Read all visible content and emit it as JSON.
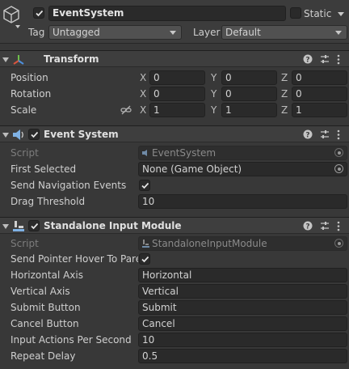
{
  "gameobject": {
    "name": "EventSystem",
    "active": true,
    "static_label": "Static",
    "static_checked": false,
    "tag_label": "Tag",
    "tag_value": "Untagged",
    "layer_label": "Layer",
    "layer_value": "Default"
  },
  "transform": {
    "title": "Transform",
    "position": {
      "label": "Position",
      "x": "0",
      "y": "0",
      "z": "0"
    },
    "rotation": {
      "label": "Rotation",
      "x": "0",
      "y": "0",
      "z": "0"
    },
    "scale": {
      "label": "Scale",
      "x": "1",
      "y": "1",
      "z": "1"
    },
    "axis_x": "X",
    "axis_y": "Y",
    "axis_z": "Z"
  },
  "event_system": {
    "title": "Event System",
    "enabled": true,
    "script_label": "Script",
    "script_value": "EventSystem",
    "first_selected_label": "First Selected",
    "first_selected_value": "None (Game Object)",
    "send_nav_label": "Send Navigation Events",
    "send_nav_checked": true,
    "drag_threshold_label": "Drag Threshold",
    "drag_threshold_value": "10"
  },
  "input_module": {
    "title": "Standalone Input Module",
    "enabled": true,
    "script_label": "Script",
    "script_value": "StandaloneInputModule",
    "send_hover_label": "Send Pointer Hover To Pare",
    "send_hover_checked": true,
    "horizontal_axis_label": "Horizontal Axis",
    "horizontal_axis_value": "Horizontal",
    "vertical_axis_label": "Vertical Axis",
    "vertical_axis_value": "Vertical",
    "submit_button_label": "Submit Button",
    "submit_button_value": "Submit",
    "cancel_button_label": "Cancel Button",
    "cancel_button_value": "Cancel",
    "input_actions_label": "Input Actions Per Second",
    "input_actions_value": "10",
    "repeat_delay_label": "Repeat Delay",
    "repeat_delay_value": "0.5"
  },
  "icons": {
    "gameobject": "cube-icon",
    "transform": "transform-axes-icon",
    "event_system": "speaker-icon",
    "input_module": "input-module-icon",
    "help": "help-icon",
    "presets": "sliders-icon",
    "menu": "kebab-menu-icon",
    "constrain": "link-icon",
    "object_picker": "target-icon"
  },
  "colors": {
    "background": "#383838",
    "header": "#3e3e3e",
    "field": "#2a2a2a",
    "text": "#d2d2d2",
    "dim_text": "#7d7d7d"
  }
}
